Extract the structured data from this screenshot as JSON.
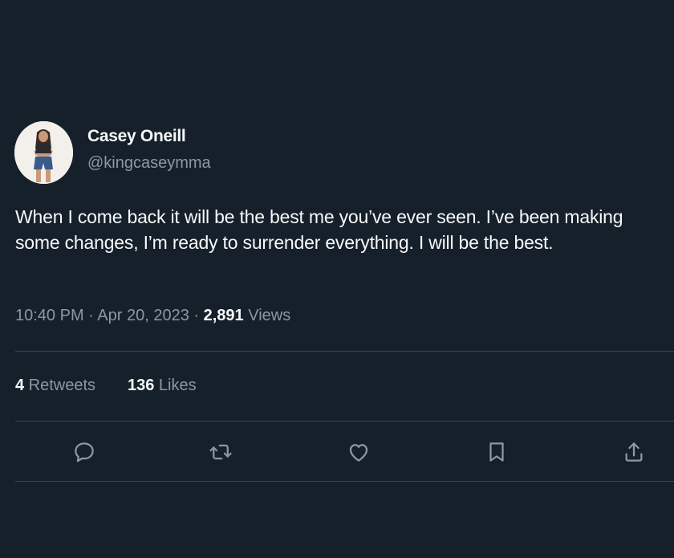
{
  "author": {
    "display_name": "Casey Oneill",
    "handle": "@kingcaseymma",
    "avatar_icon": "profile-photo"
  },
  "tweet": {
    "text": "When I come back it will be the best me you’ve ever seen. I’ve been making some changes, I’m ready to surrender everything. I will be the best.",
    "time": "10:40 PM",
    "separator": " · ",
    "date": "Apr 20, 2023",
    "views_count": "2,891",
    "views_label": " Views"
  },
  "stats": {
    "retweets_count": "4",
    "retweets_label": " Retweets",
    "likes_count": "136",
    "likes_label": " Likes"
  },
  "actions": [
    {
      "name": "reply",
      "icon": "reply-icon"
    },
    {
      "name": "retweet",
      "icon": "retweet-icon"
    },
    {
      "name": "like",
      "icon": "heart-icon"
    },
    {
      "name": "bookmark",
      "icon": "bookmark-icon"
    },
    {
      "name": "share",
      "icon": "share-icon"
    }
  ],
  "colors": {
    "background": "#15202b",
    "primary_text": "#f7f9f9",
    "secondary_text": "#8b98a5",
    "divider": "#38444d"
  }
}
